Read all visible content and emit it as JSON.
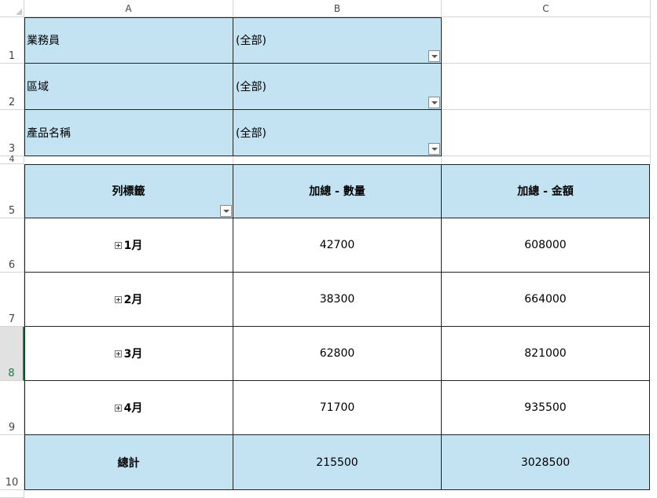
{
  "columns": [
    "A",
    "B",
    "C"
  ],
  "rows": [
    "1",
    "2",
    "3",
    "4",
    "5",
    "6",
    "7",
    "8",
    "9",
    "10"
  ],
  "selected_row": "8",
  "filters": [
    {
      "label": "業務員",
      "value": "(全部)"
    },
    {
      "label": "區域",
      "value": "(全部)"
    },
    {
      "label": "產品名稱",
      "value": "(全部)"
    }
  ],
  "pivot": {
    "header": {
      "row_labels": "列標籤",
      "qty": "加總 - 數量",
      "amount": "加總 - 金額"
    },
    "rows": [
      {
        "month": "1月",
        "qty": "42700",
        "amount": "608000"
      },
      {
        "month": "2月",
        "qty": "38300",
        "amount": "664000"
      },
      {
        "month": "3月",
        "qty": "62800",
        "amount": "821000"
      },
      {
        "month": "4月",
        "qty": "71700",
        "amount": "935500"
      }
    ],
    "total": {
      "label": "總計",
      "qty": "215500",
      "amount": "3028500"
    }
  },
  "colors": {
    "pivot_fill": "#c3e3f3",
    "selection": "#217346"
  }
}
